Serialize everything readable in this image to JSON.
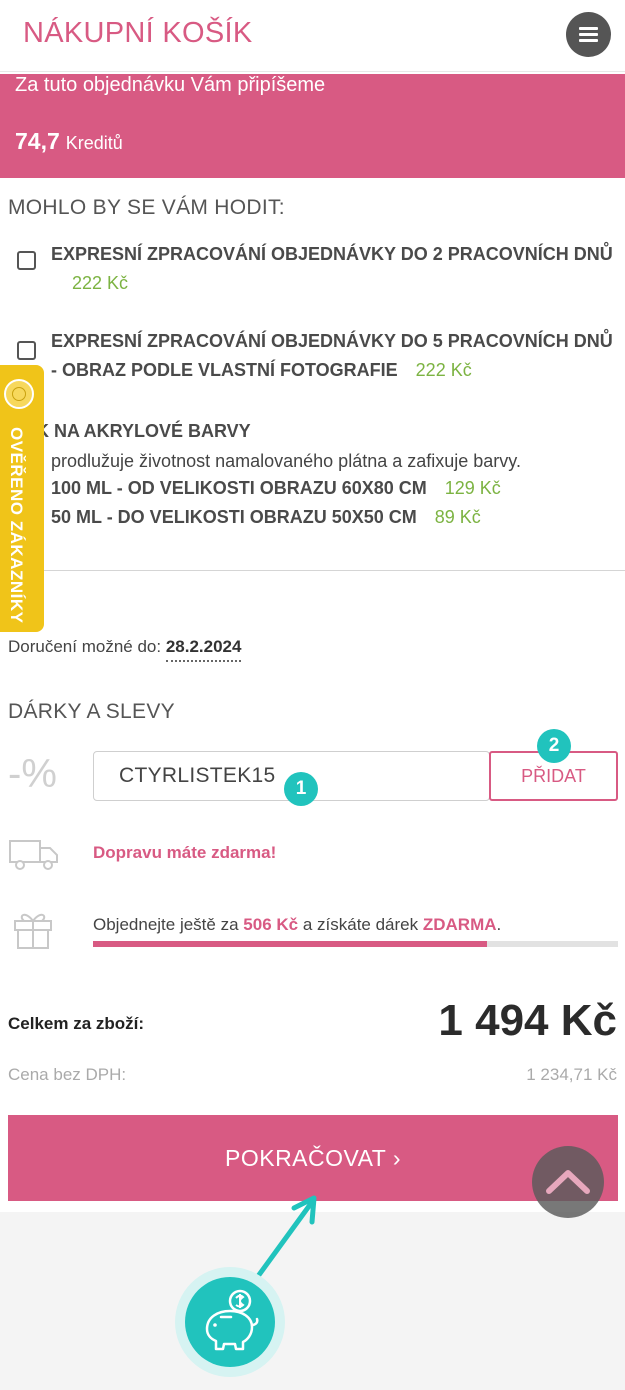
{
  "header": {
    "title": "NÁKUPNÍ KOŠÍK",
    "menu_icon": "hamburger-icon"
  },
  "credits": {
    "text": "Za tuto objednávku Vám připíšeme",
    "amount": "74,7",
    "unit": "Kreditů"
  },
  "extras": {
    "title": "MOHLO BY SE VÁM HODIT:",
    "option1": {
      "name": "EXPRESNÍ ZPRACOVÁNÍ OBJEDNÁVKY DO 2 PRACOVNÍCH DNŮ",
      "price": "222 Kč",
      "checked": false
    },
    "option2": {
      "name_line1": "EXPRESNÍ ZPRACOVÁNÍ OBJEDNÁVKY DO 5 PRACOVNÍCH DNŮ",
      "name_line2": "- OBRAZ PODLE VLASTNÍ FOTOGRAFIE",
      "price": "222 Kč",
      "checked": false
    },
    "varnish": {
      "title": "K NA AKRYLOVÉ BARVY",
      "description": "prodlužuje životnost namalovaného plátna a zafixuje barvy.",
      "items": [
        {
          "name": "100 ML - OD VELIKOSTI OBRAZU 60X80 CM",
          "price": "129 Kč"
        },
        {
          "name": "50 ML - DO VELIKOSTI OBRAZU 50X50 CM",
          "price": "89 Kč"
        }
      ]
    }
  },
  "badge": {
    "text": "OVĚŘENO ZÁKAZNÍKY",
    "seal_icon": "verified-seal-icon"
  },
  "delivery": {
    "label": "Doručení možné do:",
    "date": "28.2.2024"
  },
  "discounts": {
    "title": "DÁRKY A SLEVY",
    "percent_symbol": "-%",
    "coupon_value": "CTYRLISTEK15",
    "add_label": "PŘIDAT",
    "marker1": "1",
    "marker2": "2",
    "free_shipping": "Dopravu máte zdarma!",
    "gift_text_before": "Objednejte ještě za",
    "gift_amount": "506 Kč",
    "gift_text_middle": "a získáte dárek",
    "gift_free": "ZDARMA",
    "gift_text_end": ".",
    "gift_progress": 0.75,
    "truck_icon": "truck-icon",
    "gift_icon": "gift-icon"
  },
  "totals": {
    "goods_label": "Celkem za zboží:",
    "goods_value": "1 494 Kč",
    "novat_label": "Cena bez DPH:",
    "novat_value": "1 234,71 Kč"
  },
  "continue": {
    "label": "POKRAČOVAT ›"
  },
  "colors": {
    "accent": "#d85a83",
    "price_green": "#7cb342",
    "teal": "#21c3bd",
    "badge_yellow": "#f0c419"
  }
}
